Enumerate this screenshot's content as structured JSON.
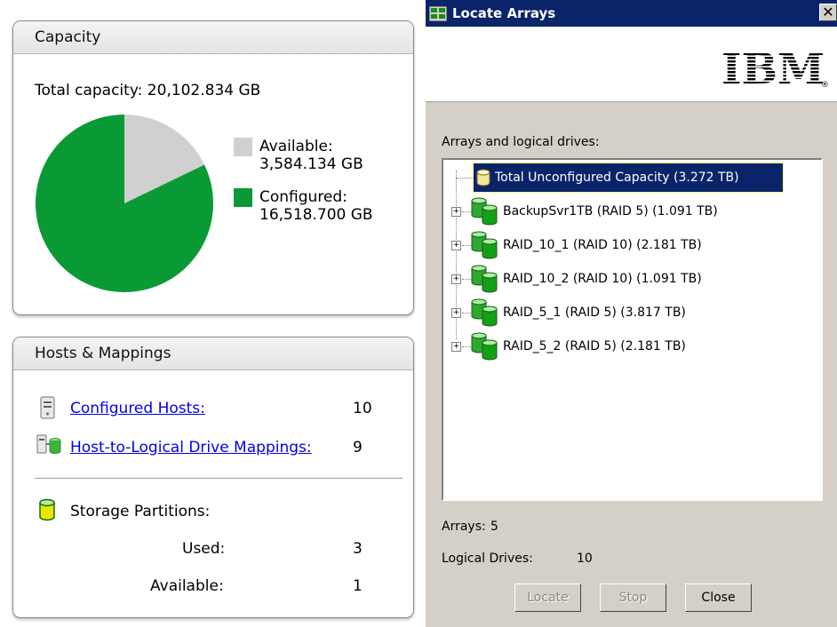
{
  "capacity": {
    "header": "Capacity",
    "total_label": "Total capacity: 20,102.834 GB",
    "legend": [
      {
        "label": "Available:",
        "value": "3,584.134 GB",
        "color": "#d0d0d0"
      },
      {
        "label": "Configured:",
        "value": "16,518.700 GB",
        "color": "#0a9a35"
      }
    ]
  },
  "chart_data": {
    "type": "pie",
    "categories": [
      "Available",
      "Configured"
    ],
    "values": [
      3584.134,
      16518.7
    ],
    "colors": [
      "#d0d0d0",
      "#0a9a35"
    ]
  },
  "hosts": {
    "header": "Hosts & Mappings",
    "configured_hosts_label": "Configured Hosts:",
    "configured_hosts_value": "10",
    "mappings_label": "Host-to-Logical Drive Mappings:",
    "mappings_value": "9",
    "partitions_label": "Storage Partitions:",
    "used_label": "Used:",
    "used_value": "3",
    "available_label": "Available:",
    "available_value": "1"
  },
  "dialog": {
    "title": "Locate Arrays",
    "close_glyph": "✕",
    "logo_text": "IBM",
    "tree_label": "Arrays and logical drives:",
    "tree": [
      {
        "label": "Total Unconfigured Capacity (3.272 TB)",
        "icon": "unconfigured-drive-icon",
        "selected": true
      },
      {
        "label": "BackupSvr1TB (RAID 5) (1.091 TB)",
        "icon": "array-icon"
      },
      {
        "label": "RAID_10_1 (RAID 10) (2.181 TB)",
        "icon": "array-icon"
      },
      {
        "label": "RAID_10_2 (RAID 10) (1.091 TB)",
        "icon": "array-icon"
      },
      {
        "label": "RAID_5_1 (RAID 5) (3.817 TB)",
        "icon": "array-icon"
      },
      {
        "label": "RAID_5_2 (RAID 5) (2.181 TB)",
        "icon": "array-icon"
      }
    ],
    "arrays_label": "Arrays:",
    "arrays_value": "5",
    "logical_label": "Logical Drives:",
    "logical_value": "10",
    "buttons": {
      "locate": "Locate",
      "stop": "Stop",
      "close": "Close"
    }
  }
}
